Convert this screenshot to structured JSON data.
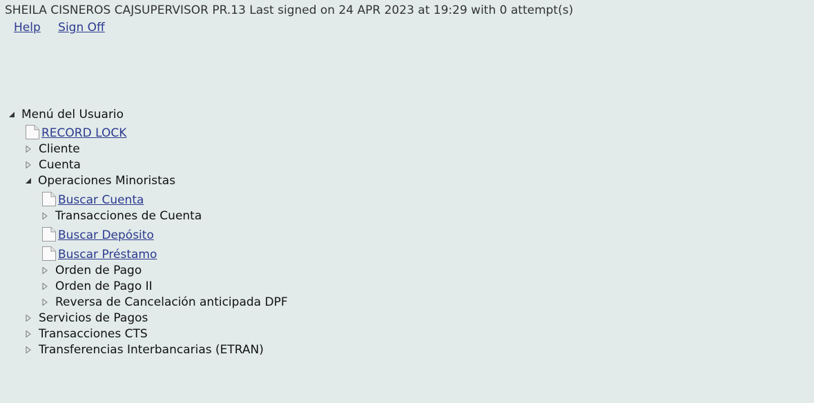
{
  "header": {
    "status_line": "SHEILA CISNEROS CAJSUPERVISOR PR.13 Last signed on 24 APR 2023 at 19:29 with 0 attempt(s)",
    "help_label": "Help",
    "signoff_label": "Sign Off"
  },
  "menu": {
    "root_label": "Menú del Usuario",
    "record_lock": "RECORD LOCK",
    "cliente": "Cliente",
    "cuenta": "Cuenta",
    "operaciones_minoristas": "Operaciones Minoristas",
    "buscar_cuenta": "Buscar Cuenta",
    "transacciones_de_cuenta": "Transacciones de Cuenta",
    "buscar_deposito": "Buscar Depósito",
    "buscar_prestamo": "Buscar Préstamo",
    "orden_de_pago": "Orden de Pago",
    "orden_de_pago_ii": "Orden de Pago II",
    "reversa_cancelacion": "Reversa de Cancelación anticipada DPF",
    "servicios_de_pagos": "Servicios de Pagos",
    "transacciones_cts": "Transacciones CTS",
    "transferencias_interbancarias": "Transferencias Interbancarias (ETRAN)"
  }
}
